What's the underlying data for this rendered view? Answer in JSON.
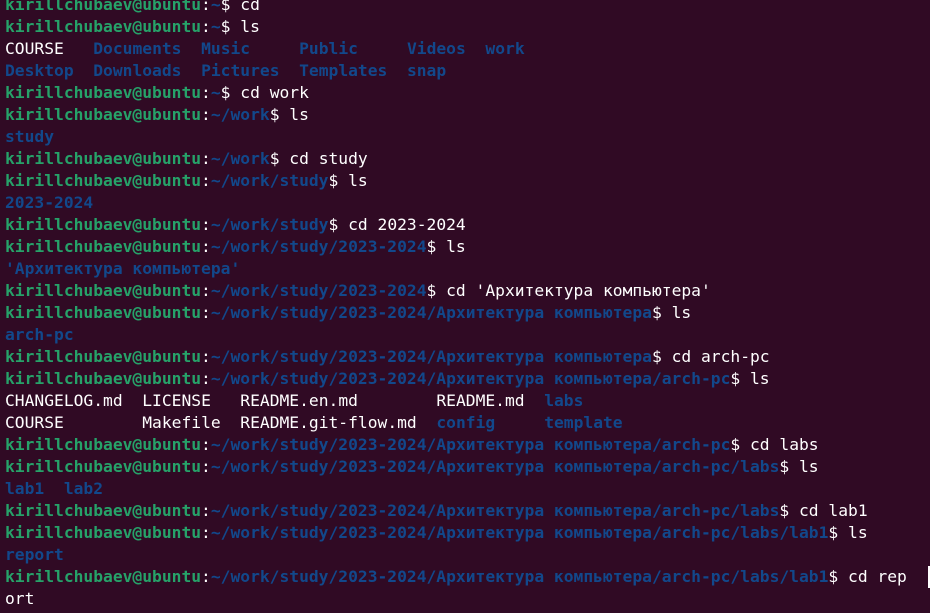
{
  "terminal": {
    "colors": {
      "background": "#300a24",
      "user_host": "#26a269",
      "path": "#12488b",
      "directory": "#12488b",
      "text": "#ffffff"
    },
    "lines": [
      {
        "type": "prompt",
        "user": "kirillchubaev@ubuntu",
        "path": "~",
        "command": "cd"
      },
      {
        "type": "prompt",
        "user": "kirillchubaev@ubuntu",
        "path": "~",
        "command": "ls"
      },
      {
        "type": "output",
        "items": [
          {
            "text": "COURSE",
            "kind": "file"
          },
          {
            "text": "   ",
            "kind": "space"
          },
          {
            "text": "Documents",
            "kind": "dir"
          },
          {
            "text": "  ",
            "kind": "space"
          },
          {
            "text": "Music",
            "kind": "dir"
          },
          {
            "text": "     ",
            "kind": "space"
          },
          {
            "text": "Public",
            "kind": "dir"
          },
          {
            "text": "     ",
            "kind": "space"
          },
          {
            "text": "Videos",
            "kind": "dir"
          },
          {
            "text": "  ",
            "kind": "space"
          },
          {
            "text": "work",
            "kind": "dir"
          }
        ]
      },
      {
        "type": "output",
        "items": [
          {
            "text": "Desktop",
            "kind": "dir"
          },
          {
            "text": "  ",
            "kind": "space"
          },
          {
            "text": "Downloads",
            "kind": "dir"
          },
          {
            "text": "  ",
            "kind": "space"
          },
          {
            "text": "Pictures",
            "kind": "dir"
          },
          {
            "text": "  ",
            "kind": "space"
          },
          {
            "text": "Templates",
            "kind": "dir"
          },
          {
            "text": "  ",
            "kind": "space"
          },
          {
            "text": "snap",
            "kind": "dir"
          }
        ]
      },
      {
        "type": "prompt",
        "user": "kirillchubaev@ubuntu",
        "path": "~",
        "command": "cd work"
      },
      {
        "type": "prompt",
        "user": "kirillchubaev@ubuntu",
        "path": "~/work",
        "command": "ls"
      },
      {
        "type": "output",
        "items": [
          {
            "text": "study",
            "kind": "dir"
          }
        ]
      },
      {
        "type": "prompt",
        "user": "kirillchubaev@ubuntu",
        "path": "~/work",
        "command": "cd study"
      },
      {
        "type": "prompt",
        "user": "kirillchubaev@ubuntu",
        "path": "~/work/study",
        "command": "ls"
      },
      {
        "type": "output",
        "items": [
          {
            "text": "2023-2024",
            "kind": "dir"
          }
        ]
      },
      {
        "type": "prompt",
        "user": "kirillchubaev@ubuntu",
        "path": "~/work/study",
        "command": "cd 2023-2024"
      },
      {
        "type": "prompt",
        "user": "kirillchubaev@ubuntu",
        "path": "~/work/study/2023-2024",
        "command": "ls"
      },
      {
        "type": "output",
        "items": [
          {
            "text": "'Архитектура компьютера'",
            "kind": "dir"
          }
        ]
      },
      {
        "type": "prompt",
        "user": "kirillchubaev@ubuntu",
        "path": "~/work/study/2023-2024",
        "command": "cd 'Архитектура компьютера'"
      },
      {
        "type": "prompt",
        "user": "kirillchubaev@ubuntu",
        "path": "~/work/study/2023-2024/Архитектура компьютера",
        "command": "ls"
      },
      {
        "type": "output",
        "items": [
          {
            "text": "arch-pc",
            "kind": "dir"
          }
        ]
      },
      {
        "type": "prompt",
        "user": "kirillchubaev@ubuntu",
        "path": "~/work/study/2023-2024/Архитектура компьютера",
        "command": "cd arch-pc"
      },
      {
        "type": "prompt",
        "user": "kirillchubaev@ubuntu",
        "path": "~/work/study/2023-2024/Архитектура компьютера/arch-pc",
        "command": "ls"
      },
      {
        "type": "output",
        "items": [
          {
            "text": "CHANGELOG.md",
            "kind": "file"
          },
          {
            "text": "  ",
            "kind": "space"
          },
          {
            "text": "LICENSE",
            "kind": "file"
          },
          {
            "text": "   ",
            "kind": "space"
          },
          {
            "text": "README.en.md",
            "kind": "file"
          },
          {
            "text": "        ",
            "kind": "space"
          },
          {
            "text": "README.md",
            "kind": "file"
          },
          {
            "text": "  ",
            "kind": "space"
          },
          {
            "text": "labs",
            "kind": "dir"
          }
        ]
      },
      {
        "type": "output",
        "items": [
          {
            "text": "COURSE",
            "kind": "file"
          },
          {
            "text": "        ",
            "kind": "space"
          },
          {
            "text": "Makefile",
            "kind": "file"
          },
          {
            "text": "  ",
            "kind": "space"
          },
          {
            "text": "README.git-flow.md",
            "kind": "file"
          },
          {
            "text": "  ",
            "kind": "space"
          },
          {
            "text": "config",
            "kind": "dir"
          },
          {
            "text": "     ",
            "kind": "space"
          },
          {
            "text": "template",
            "kind": "dir"
          }
        ]
      },
      {
        "type": "prompt",
        "user": "kirillchubaev@ubuntu",
        "path": "~/work/study/2023-2024/Архитектура компьютера/arch-pc",
        "command": "cd labs"
      },
      {
        "type": "prompt",
        "user": "kirillchubaev@ubuntu",
        "path": "~/work/study/2023-2024/Архитектура компьютера/arch-pc/labs",
        "command": "ls"
      },
      {
        "type": "output",
        "items": [
          {
            "text": "lab1",
            "kind": "dir"
          },
          {
            "text": "  ",
            "kind": "space"
          },
          {
            "text": "lab2",
            "kind": "dir"
          }
        ]
      },
      {
        "type": "prompt",
        "user": "kirillchubaev@ubuntu",
        "path": "~/work/study/2023-2024/Архитектура компьютера/arch-pc/labs",
        "command": "cd lab1"
      },
      {
        "type": "prompt",
        "user": "kirillchubaev@ubuntu",
        "path": "~/work/study/2023-2024/Архитектура компьютера/arch-pc/labs/lab1",
        "command": "ls"
      },
      {
        "type": "output",
        "items": [
          {
            "text": "report",
            "kind": "dir"
          }
        ]
      },
      {
        "type": "prompt",
        "user": "kirillchubaev@ubuntu",
        "path": "~/work/study/2023-2024/Архитектура компьютера/arch-pc/labs/lab1",
        "command": "cd rep"
      },
      {
        "type": "output",
        "items": [
          {
            "text": "ort",
            "kind": "file"
          }
        ]
      }
    ]
  }
}
